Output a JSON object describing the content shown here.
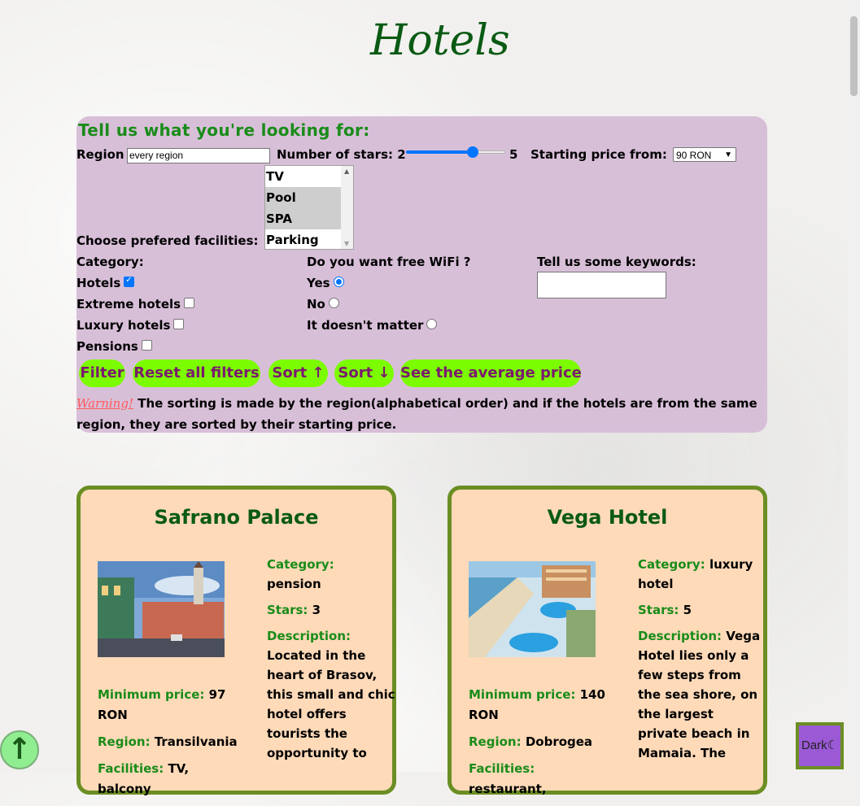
{
  "page_title": "Hotels",
  "filters": {
    "heading": "Tell us what you're looking for:",
    "region_label": "Region",
    "region_value": "every region",
    "stars_label": "Number of stars: 2",
    "stars_max": "5",
    "stars_value": 4,
    "price_label": "Starting price from:",
    "price_selected": "90 RON",
    "facilities_label": "Choose prefered facilities:",
    "facilities_options": [
      {
        "label": "TV",
        "selected": false
      },
      {
        "label": "Pool",
        "selected": true
      },
      {
        "label": "SPA",
        "selected": true
      },
      {
        "label": "Parking lot",
        "selected": false
      }
    ],
    "category_label": "Category:",
    "categories": [
      {
        "label": "Hotels",
        "checked": true
      },
      {
        "label": "Extreme hotels",
        "checked": false
      },
      {
        "label": "Luxury hotels",
        "checked": false
      },
      {
        "label": "Pensions",
        "checked": false
      }
    ],
    "wifi_label": "Do you want free WiFi ?",
    "wifi_options": [
      {
        "label": "Yes",
        "checked": true
      },
      {
        "label": "No",
        "checked": false
      },
      {
        "label": "It doesn't matter",
        "checked": false
      }
    ],
    "keywords_label": "Tell us some keywords:",
    "buttons": {
      "filter": "Filter",
      "reset": "Reset all filters",
      "sort_up": "Sort",
      "sort_down": "Sort",
      "average": "See the average price"
    },
    "warning_word": "Warning!",
    "warning_text": " The sorting is made by the region(alphabetical order) and if the hotels are from the same region, they are sorted by their starting price."
  },
  "hotels": [
    {
      "name": "Safrano Palace",
      "category_label": "Category:",
      "category": "pension",
      "stars_label": "Stars:",
      "stars": "3",
      "description_label": "Description:",
      "description": "Located in the heart of Brasov, this small and chic hotel offers tourists the opportunity to",
      "min_price_label": "Minimum price:",
      "min_price": "97 RON",
      "region_label": "Region:",
      "region": "Transilvania",
      "facilities_label": "Facilities:",
      "facilities": "TV, balcony"
    },
    {
      "name": "Vega Hotel",
      "category_label": "Category:",
      "category": "luxury hotel",
      "stars_label": "Stars:",
      "stars": "5",
      "description_label": "Description:",
      "description": "Vega Hotel lies only a few steps from the sea shore, on the largest private beach in Mamaia. The",
      "min_price_label": "Minimum price:",
      "min_price": "140 RON",
      "region_label": "Region:",
      "region": "Dobrogea",
      "facilities_label": "Facilities:",
      "facilities": "restaurant,"
    }
  ],
  "dark_button": "Dark",
  "colors": {
    "title_green": "#0a5a14",
    "panel": "#d8bfd8",
    "button": "#7cfc00",
    "card": "#ffdab9",
    "card_border": "#6b8e23"
  }
}
